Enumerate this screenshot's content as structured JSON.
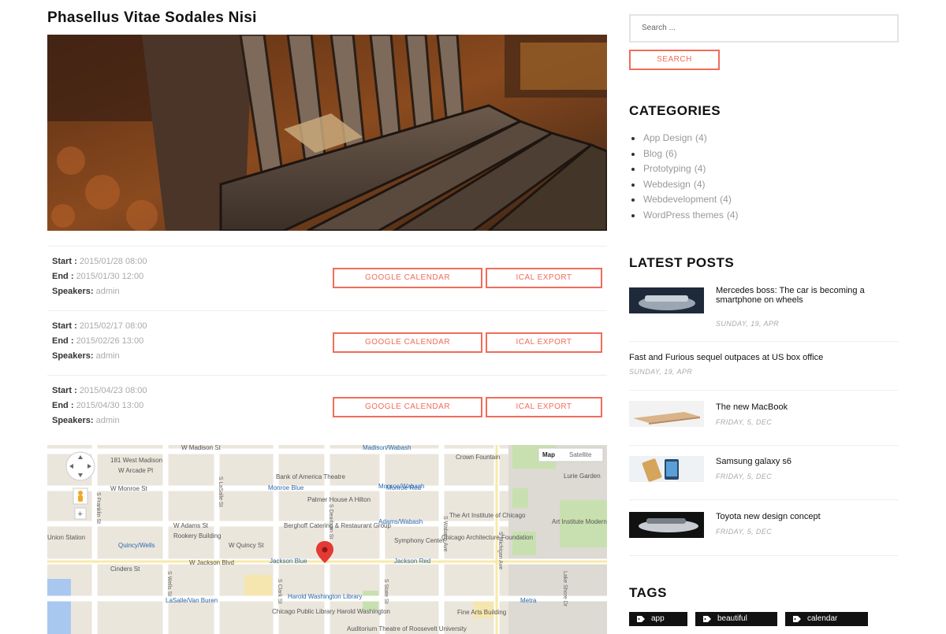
{
  "post": {
    "title": "Phasellus Vitae Sodales Nisi",
    "events": [
      {
        "start_label": "Start :",
        "start": "2015/01/28 08:00",
        "end_label": "End :",
        "end": "2015/01/30 12:00",
        "speakers_label": "Speakers:",
        "speakers": "admin"
      },
      {
        "start_label": "Start :",
        "start": "2015/02/17 08:00",
        "end_label": "End :",
        "end": "2015/02/26 13:00",
        "speakers_label": "Speakers:",
        "speakers": "admin"
      },
      {
        "start_label": "Start :",
        "start": "2015/04/23 08:00",
        "end_label": "End :",
        "end": "2015/04/30 13:00",
        "speakers_label": "Speakers:",
        "speakers": "admin"
      }
    ],
    "buttons": {
      "google": "GOOGLE CALENDAR",
      "ical": "ICAL EXPORT"
    }
  },
  "map": {
    "type_map": "Map",
    "type_satellite": "Satellite",
    "labels": [
      "W Madison St",
      "Madison/Wabash",
      "181 West Madison",
      "W Arcade Pl",
      "Bank of America Theatre",
      "Monroe/Wabash",
      "W Monroe St",
      "Monroe Blue",
      "Monroe Red",
      "Palmer House A Hilton",
      "W Adams St",
      "Rookery Building",
      "Berghoff Catering & Restaurant Group",
      "Adams/Wabash",
      "The Art Institute of Chicago",
      "Quincy/Wells",
      "W Quincy St",
      "Symphony Center",
      "W Jackson Blvd",
      "Jackson Blue",
      "Jackson Red",
      "LaSalle/Van Buren",
      "Harold Washington Library",
      "Chicago Public Library Harold Washington",
      "Auditorium Theatre of Roosevelt University",
      "Crown Fountain",
      "Lurie Garden",
      "Chicago Architecture Foundation",
      "Art Institute Modern Wing",
      "Fine Arts Building",
      "Union Station",
      "Metra",
      "Cinders St",
      "S Michigan Ave",
      "S Wabash Ave",
      "S State St",
      "S Dearborn St",
      "S Clark St",
      "S LaSalle St",
      "S Wells St",
      "S Franklin St",
      "Lake Shore Dr"
    ]
  },
  "sidebar": {
    "search_placeholder": "Search ...",
    "search_button": "SEARCH",
    "categories_title": "CATEGORIES",
    "categories": [
      {
        "name": "App Design",
        "count": "(4)"
      },
      {
        "name": "Blog",
        "count": "(6)"
      },
      {
        "name": "Prototyping",
        "count": "(4)"
      },
      {
        "name": "Webdesign",
        "count": "(4)"
      },
      {
        "name": "Webdevelopment",
        "count": "(4)"
      },
      {
        "name": "WordPress themes",
        "count": "(4)"
      }
    ],
    "latest_title": "LATEST POSTS",
    "latest_posts": [
      {
        "title": "Mercedes boss: The car is becoming a smartphone on wheels",
        "date": "SUNDAY, 19, APR"
      },
      {
        "title": "Fast and Furious sequel outpaces at US box office",
        "date": "SUNDAY, 19, APR"
      },
      {
        "title": "The new MacBook",
        "date": "FRIDAY, 5, DEC"
      },
      {
        "title": "Samsung galaxy s6",
        "date": "FRIDAY, 5, DEC"
      },
      {
        "title": "Toyota new design concept",
        "date": "FRIDAY, 5, DEC"
      }
    ],
    "tags_title": "TAGS",
    "tags": [
      "app",
      "beautiful",
      "calendar"
    ]
  },
  "colors": {
    "accent": "#f26c5a",
    "text": "#111111",
    "muted": "#aaaaaa"
  }
}
